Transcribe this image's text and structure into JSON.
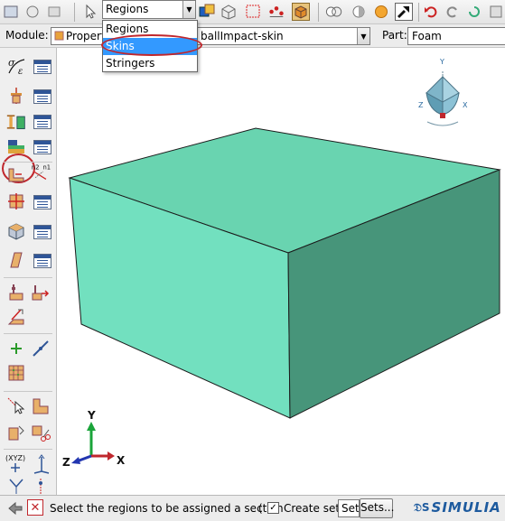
{
  "toolbar": {
    "region_filter": "Regions"
  },
  "dropdown": {
    "options": [
      "Regions",
      "Skins",
      "Stringers"
    ],
    "selected_index": 1
  },
  "module_bar": {
    "module_label": "Module:",
    "module_value": "Property",
    "model_value": "ballImpact-skin",
    "part_label": "Part:",
    "part_value": "Foam"
  },
  "viewport": {
    "triad": {
      "y": "Y",
      "z": "Z",
      "x": "X"
    },
    "view_cube": {
      "y": "Y",
      "z": "Z",
      "x": "X"
    },
    "colors": {
      "box_top": "#69d4b0",
      "box_front": "#72e0bf",
      "box_side": "#47957a",
      "background": "#ffffff"
    }
  },
  "prompt": {
    "text": "Select the regions to be assigned a section",
    "paren": "(",
    "create_set_label": "Create set:",
    "create_set_checked": true,
    "set_name": "Set",
    "sets_button": "Sets..."
  },
  "brand": {
    "logo_text": "SIMULIA"
  },
  "icons": [
    "pointer-arrow-icon",
    "select-box-icon",
    "nodes-icon",
    "shaded-box-icon",
    "render-icon",
    "zoom-icon",
    "undo-icon",
    "redo-icon",
    "create-material-icon",
    "create-section-icon",
    "assign-section-icon",
    "assign-orientation-icon",
    "create-composite-icon",
    "view-cube-icon",
    "xyz-triad-icon",
    "back-arrow-icon",
    "cancel-icon"
  ]
}
